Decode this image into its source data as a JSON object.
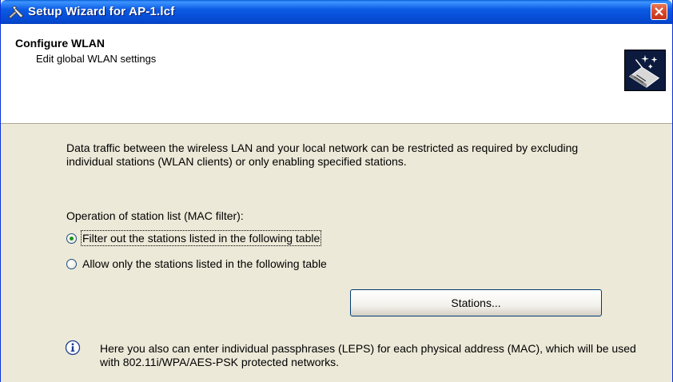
{
  "window": {
    "title": "Setup Wizard for AP-1.lcf"
  },
  "header": {
    "title": "Configure WLAN",
    "subtitle": "Edit global WLAN settings"
  },
  "body": {
    "description": "Data traffic between the wireless LAN and your local network can be restricted as required by excluding individual stations (WLAN clients) or only enabling specified stations.",
    "operation_label": "Operation of station list (MAC filter):",
    "options": [
      {
        "label": "Filter out the stations listed in the following table",
        "selected": true
      },
      {
        "label": "Allow only the stations listed in the following table",
        "selected": false
      }
    ],
    "stations_button": "Stations...",
    "info_text": "Here you also can enter individual passphrases (LEPS) for each physical address (MAC), which will be used with 802.11i/WPA/AES-PSK protected networks."
  },
  "icons": [
    "wizard-wand-icon",
    "close-icon",
    "wizard-header-icon",
    "info-icon"
  ],
  "colors": {
    "titlebar": "#0548d0",
    "dialog_bg": "#ece9d8",
    "close": "#d9482a"
  }
}
